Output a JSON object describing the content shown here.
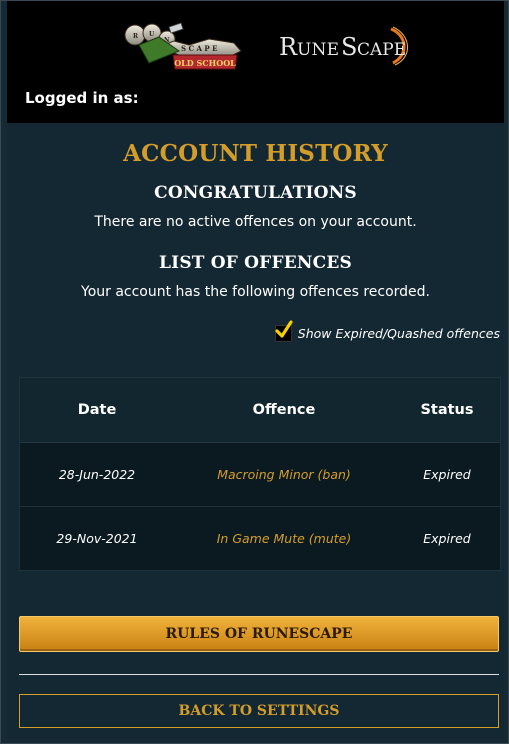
{
  "header": {
    "osrs_logo": {
      "icon": "osrs-logo",
      "top_text": "RUNE SCAPE",
      "sub_text": "OLD SCHOOL"
    },
    "rs_logo": {
      "icon": "runescape-logo",
      "text": "RUNESCAPE"
    },
    "logged_in_label": "Logged in as:"
  },
  "page": {
    "title": "ACCOUNT HISTORY",
    "congrats_heading": "CONGRATULATIONS",
    "congrats_text": "There are no active offences on your account.",
    "list_heading": "LIST OF OFFENCES",
    "list_text": "Your account has the following offences recorded.",
    "show_expired": {
      "label": "Show Expired/Quashed offences",
      "checked": true
    }
  },
  "table": {
    "headers": [
      "Date",
      "Offence",
      "Status"
    ],
    "rows": [
      {
        "date": "28-Jun-2022",
        "offence": "Macroing Minor (ban)",
        "status": "Expired"
      },
      {
        "date": "29-Nov-2021",
        "offence": "In Game Mute (mute)",
        "status": "Expired"
      }
    ]
  },
  "buttons": {
    "rules": "RULES OF RUNESCAPE",
    "back": "BACK TO SETTINGS"
  },
  "colors": {
    "accent_gold": "#d49d2a",
    "background": "#142833",
    "topbar": "#000000"
  }
}
